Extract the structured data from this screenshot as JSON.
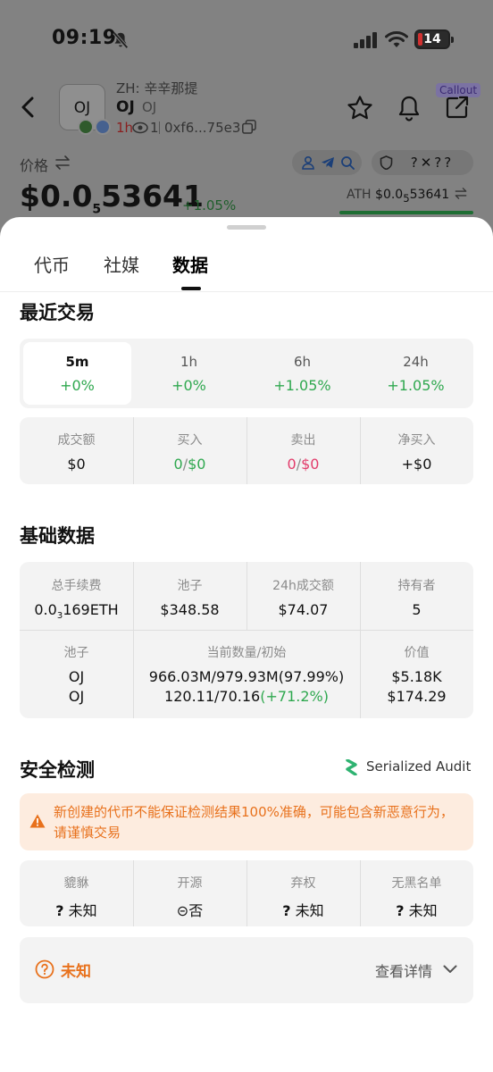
{
  "status_bar": {
    "time": "09:19",
    "battery": "14"
  },
  "token": {
    "logo_text": "OJ",
    "zh_name": "ZH: 辛辛那提",
    "symbol": "OJ",
    "symbol_secondary": "OJ",
    "age": "1h",
    "views": "1",
    "address": "0xf6...75e3",
    "callout_label": "Callout"
  },
  "price_header": {
    "label": "价格",
    "price_prefix": "$0.0",
    "price_sub": "5",
    "price_rest": "53641",
    "change": "+1.05%",
    "ath_label": "ATH",
    "ath_prefix": "$0.0",
    "ath_sub": "5",
    "ath_rest": "53641",
    "safety_badges": "?✕??"
  },
  "tabs": [
    {
      "label": "代币"
    },
    {
      "label": "社媒"
    },
    {
      "label": "数据"
    }
  ],
  "recent_trades": {
    "title": "最近交易",
    "timeframes": [
      {
        "label": "5m",
        "change": "+0%"
      },
      {
        "label": "1h",
        "change": "+0%"
      },
      {
        "label": "6h",
        "change": "+1.05%"
      },
      {
        "label": "24h",
        "change": "+1.05%"
      }
    ],
    "stats": {
      "volume_label": "成交额",
      "volume": "$0",
      "buy_label": "买入",
      "buy_count": "0",
      "buy_amount": "$0",
      "sell_label": "卖出",
      "sell_count": "0",
      "sell_amount": "$0",
      "net_buy_label": "净买入",
      "net_buy": "+$0"
    }
  },
  "basic_data": {
    "title": "基础数据",
    "fees_label": "总手续费",
    "fees_prefix": "0.0",
    "fees_sub": "3",
    "fees_rest": "169ETH",
    "pool_label": "池子",
    "pool_value": "$348.58",
    "vol24_label": "24h成交额",
    "vol24_value": "$74.07",
    "holders_label": "持有者",
    "holders_value": "5",
    "pool_col_label": "池子",
    "amount_col_label": "当前数量/初始",
    "value_col_label": "价值",
    "pool_rows": [
      {
        "token": "OJ",
        "amount": "966.03M/979.93M(97.99%)",
        "amount_pct": "",
        "value": "$5.18K"
      },
      {
        "token": "OJ",
        "amount": "120.11/70.16",
        "amount_pct": "(+71.2%)",
        "value": "$174.29"
      }
    ]
  },
  "security": {
    "title": "安全检测",
    "audit_provider": "Serialized Audit",
    "warning": "新创建的代币不能保证检测结果100%准确，可能包含新恶意行为，请谨慎交易",
    "checks": [
      {
        "label": "貔貅",
        "symbol": "?",
        "value": "未知"
      },
      {
        "label": "开源",
        "symbol": "⊝",
        "value": "否"
      },
      {
        "label": "弃权",
        "symbol": "?",
        "value": "未知"
      },
      {
        "label": "无黑名单",
        "symbol": "?",
        "value": "未知"
      }
    ],
    "overall": "未知",
    "details_link": "查看详情"
  },
  "colors": {
    "positive": "#2fa84f",
    "negative": "#e23c6b",
    "warning": "#e8711c",
    "warning_bg": "#fdecdf",
    "panel_bg": "#f3f3f3"
  }
}
